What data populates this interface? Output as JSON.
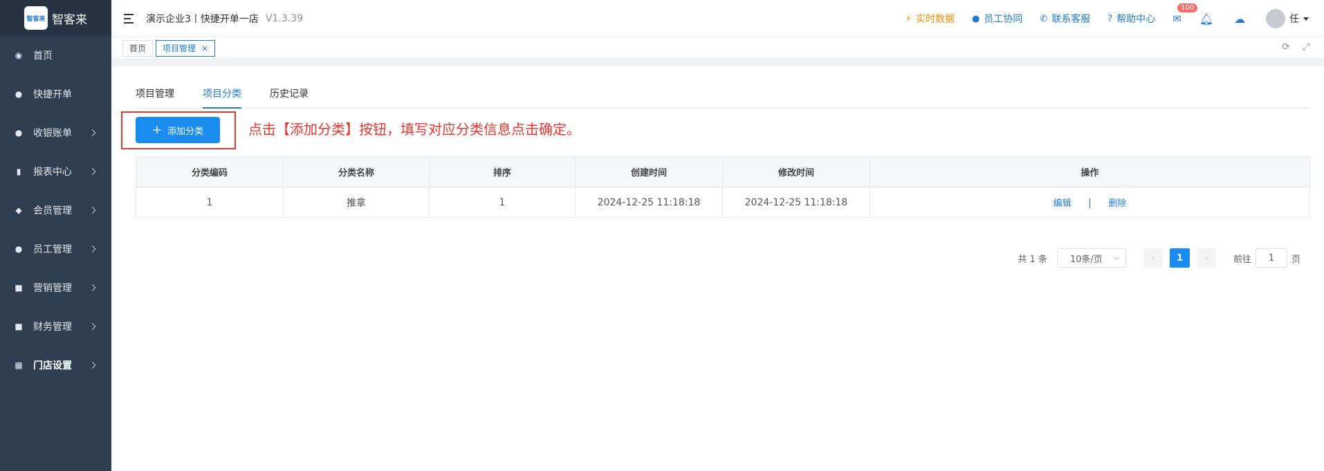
{
  "app": {
    "logo_badge": "智客来",
    "logo_text": "智客来"
  },
  "sidebar": {
    "items": [
      {
        "label": "首页",
        "icon": "dashboard-icon",
        "has_arrow": false
      },
      {
        "label": "快捷开单",
        "icon": "money-bag-icon",
        "has_arrow": false
      },
      {
        "label": "收银账单",
        "icon": "money-bag-icon",
        "has_arrow": true
      },
      {
        "label": "报表中心",
        "icon": "bar-chart-icon",
        "has_arrow": true
      },
      {
        "label": "会员管理",
        "icon": "diamond-icon",
        "has_arrow": true
      },
      {
        "label": "员工管理",
        "icon": "user-icon",
        "has_arrow": true
      },
      {
        "label": "营销管理",
        "icon": "briefcase-icon",
        "has_arrow": true
      },
      {
        "label": "财务管理",
        "icon": "wallet-icon",
        "has_arrow": true
      },
      {
        "label": "门店设置",
        "icon": "grid-icon",
        "has_arrow": true,
        "active": true
      }
    ]
  },
  "header": {
    "company": "演示企业3丨快捷开单一店",
    "version": "V1.3.39",
    "links": {
      "realtime": "实时数据",
      "staff": "员工协同",
      "service": "联系客服",
      "help": "帮助中心"
    },
    "mail_badge": "100",
    "user_name": "任"
  },
  "tags": {
    "home": "首页",
    "current": "项目管理",
    "close": "×"
  },
  "subtabs": [
    "项目管理",
    "项目分类",
    "历史记录"
  ],
  "toolbar": {
    "add_label": "添加分类",
    "hint": "点击【添加分类】按钮，填写对应分类信息点击确定。"
  },
  "table": {
    "headers": [
      "分类编码",
      "分类名称",
      "排序",
      "创建时间",
      "修改时间",
      "操作"
    ],
    "rows": [
      {
        "code": "1",
        "name": "推拿",
        "sort": "1",
        "created": "2024-12-25 11:18:18",
        "modified": "2024-12-25 11:18:18",
        "edit": "编辑",
        "sep": "|",
        "delete": "删除"
      }
    ]
  },
  "pagination": {
    "total": "共 1 条",
    "page_size": "10条/页",
    "current": "1",
    "goto_prefix": "前往",
    "goto_value": "1",
    "goto_suffix": "页"
  },
  "colors": {
    "accent": "#1a8cf0",
    "sidebar": "#2f3e50",
    "highlight": "#e8362f",
    "orange": "#f08c00"
  }
}
